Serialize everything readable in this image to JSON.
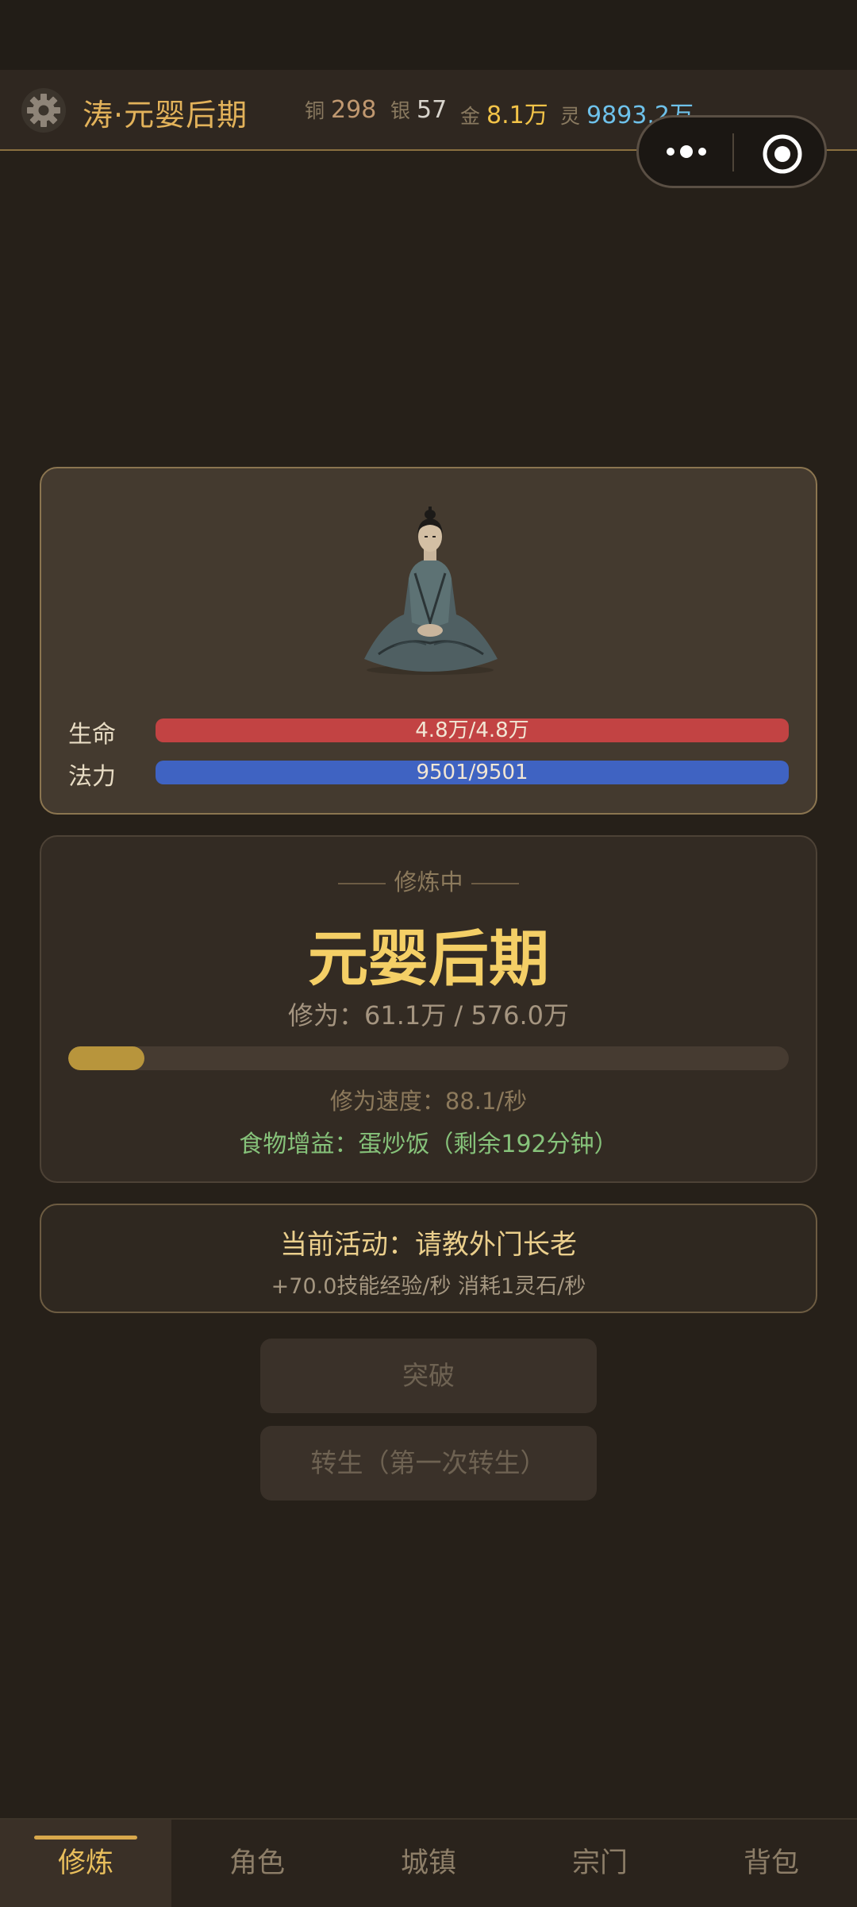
{
  "header": {
    "title": "涛·元婴后期",
    "currencies": [
      {
        "label": "铜",
        "value": "298",
        "color": "#c09870"
      },
      {
        "label": "银",
        "value": "57",
        "color": "#d8d4cc"
      },
      {
        "label": "金",
        "value": "8.1万",
        "color": "#f2c348"
      },
      {
        "label": "灵",
        "value": "9893.2万",
        "color": "#6ec1ea"
      }
    ]
  },
  "character": {
    "hp": {
      "label": "生命",
      "text": "4.8万/4.8万",
      "fraction": 1.0,
      "color": "#c24343"
    },
    "mp": {
      "label": "法力",
      "text": "9501/9501",
      "fraction": 1.0,
      "color": "#3f63c2"
    }
  },
  "cultivation": {
    "state_label": "修炼中",
    "realm": "元婴后期",
    "progress_text": "修为：61.1万 / 576.0万",
    "progress_fraction": 0.106,
    "speed_text": "修为速度：88.1/秒",
    "food_text": "食物增益：蛋炒饭（剩余192分钟）"
  },
  "activity": {
    "title": "当前活动：请教外门长老",
    "detail": "+70.0技能经验/秒  消耗1灵石/秒"
  },
  "buttons": {
    "breakthrough": "突破",
    "rebirth": "转生（第一次转生）"
  },
  "nav": {
    "tabs": [
      {
        "label": "修炼",
        "active": true
      },
      {
        "label": "角色",
        "active": false
      },
      {
        "label": "城镇",
        "active": false
      },
      {
        "label": "宗门",
        "active": false
      },
      {
        "label": "背包",
        "active": false
      }
    ]
  }
}
